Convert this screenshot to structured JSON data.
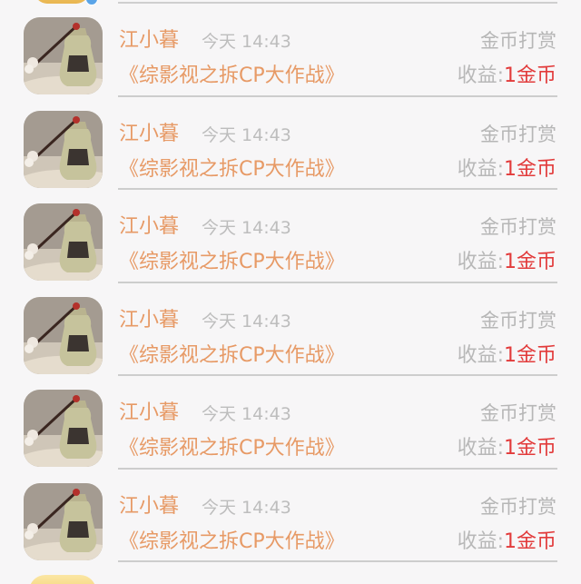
{
  "items": [
    {
      "name": "江小暮",
      "time": "今天 14:43",
      "type": "金币打赏",
      "book": "《综影视之拆CP大作战》",
      "income_label": "收益:",
      "income_value": "1金币"
    },
    {
      "name": "江小暮",
      "time": "今天 14:43",
      "type": "金币打赏",
      "book": "《综影视之拆CP大作战》",
      "income_label": "收益:",
      "income_value": "1金币"
    },
    {
      "name": "江小暮",
      "time": "今天 14:43",
      "type": "金币打赏",
      "book": "《综影视之拆CP大作战》",
      "income_label": "收益:",
      "income_value": "1金币"
    },
    {
      "name": "江小暮",
      "time": "今天 14:43",
      "type": "金币打赏",
      "book": "《综影视之拆CP大作战》",
      "income_label": "收益:",
      "income_value": "1金币"
    },
    {
      "name": "江小暮",
      "time": "今天 14:43",
      "type": "金币打赏",
      "book": "《综影视之拆CP大作战》",
      "income_label": "收益:",
      "income_value": "1金币"
    },
    {
      "name": "江小暮",
      "time": "今天 14:43",
      "type": "金币打赏",
      "book": "《综影视之拆CP大作战》",
      "income_label": "收益:",
      "income_value": "1金币"
    }
  ],
  "colors": {
    "name": "#e79a66",
    "meta": "#bdbdbd",
    "income_value": "#e23b3b",
    "background": "#f7f6f7"
  }
}
